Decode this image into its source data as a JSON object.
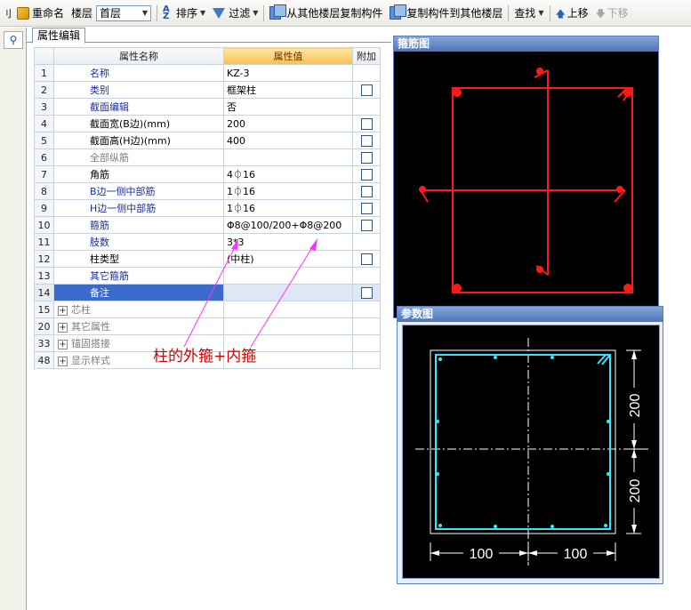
{
  "toolbar": {
    "rename_label": "重命名",
    "floor_label": "楼层",
    "floor_value": "首层",
    "sort_label": "排序",
    "filter_label": "过滤",
    "copy_from_label": "从其他楼层复制构件",
    "copy_to_label": "复制构件到其他楼层",
    "find_label": "查找",
    "up_label": "上移",
    "down_label": "下移"
  },
  "tab": {
    "label": "属性编辑"
  },
  "grid": {
    "headers": {
      "name": "属性名称",
      "value": "属性值",
      "extra": "附加"
    },
    "rows": [
      {
        "num": "1",
        "name": "名称",
        "value": "KZ-3",
        "check": false
      },
      {
        "num": "2",
        "name": "类别",
        "value": "框架柱",
        "check": true
      },
      {
        "num": "3",
        "name": "截面编辑",
        "value": "否",
        "check": false
      },
      {
        "num": "4",
        "name": "截面宽(B边)(mm)",
        "value": "200",
        "check": true
      },
      {
        "num": "5",
        "name": "截面高(H边)(mm)",
        "value": "400",
        "check": true
      },
      {
        "num": "6",
        "name": "全部纵筋",
        "value": "",
        "check": true
      },
      {
        "num": "7",
        "name": "角筋",
        "value": "4⏀16",
        "check": true
      },
      {
        "num": "8",
        "name": "B边一侧中部筋",
        "value": "1⏀16",
        "check": true
      },
      {
        "num": "9",
        "name": "H边一侧中部筋",
        "value": "1⏀16",
        "check": true
      },
      {
        "num": "10",
        "name": "箍筋",
        "value": "Φ8@100/200+Φ8@200",
        "check": true
      },
      {
        "num": "11",
        "name": "肢数",
        "value": "3*3",
        "check": false
      },
      {
        "num": "12",
        "name": "柱类型",
        "value": "(中柱)",
        "check": true
      },
      {
        "num": "13",
        "name": "其它箍筋",
        "value": "",
        "check": false
      },
      {
        "num": "14",
        "name": "备注",
        "value": "",
        "check": true
      },
      {
        "num": "15",
        "name": "芯柱",
        "value": "",
        "check": false
      },
      {
        "num": "20",
        "name": "其它属性",
        "value": "",
        "check": false
      },
      {
        "num": "33",
        "name": "锚固搭接",
        "value": "",
        "check": false
      },
      {
        "num": "48",
        "name": "显示样式",
        "value": "",
        "check": false
      }
    ]
  },
  "annotation": "柱的外箍+内箍",
  "panels": {
    "rebar_title": "箍筋图",
    "param_title": "参数图",
    "dim_200_top": "200",
    "dim_200_bottom": "200",
    "dim_100_left": "100",
    "dim_100_right": "100"
  },
  "colors": {
    "rebar_red": "#ff1a1a",
    "param_cyan": "#33e6ff",
    "annotation_red": "#d40000",
    "selection_blue": "#3a6bcb"
  }
}
